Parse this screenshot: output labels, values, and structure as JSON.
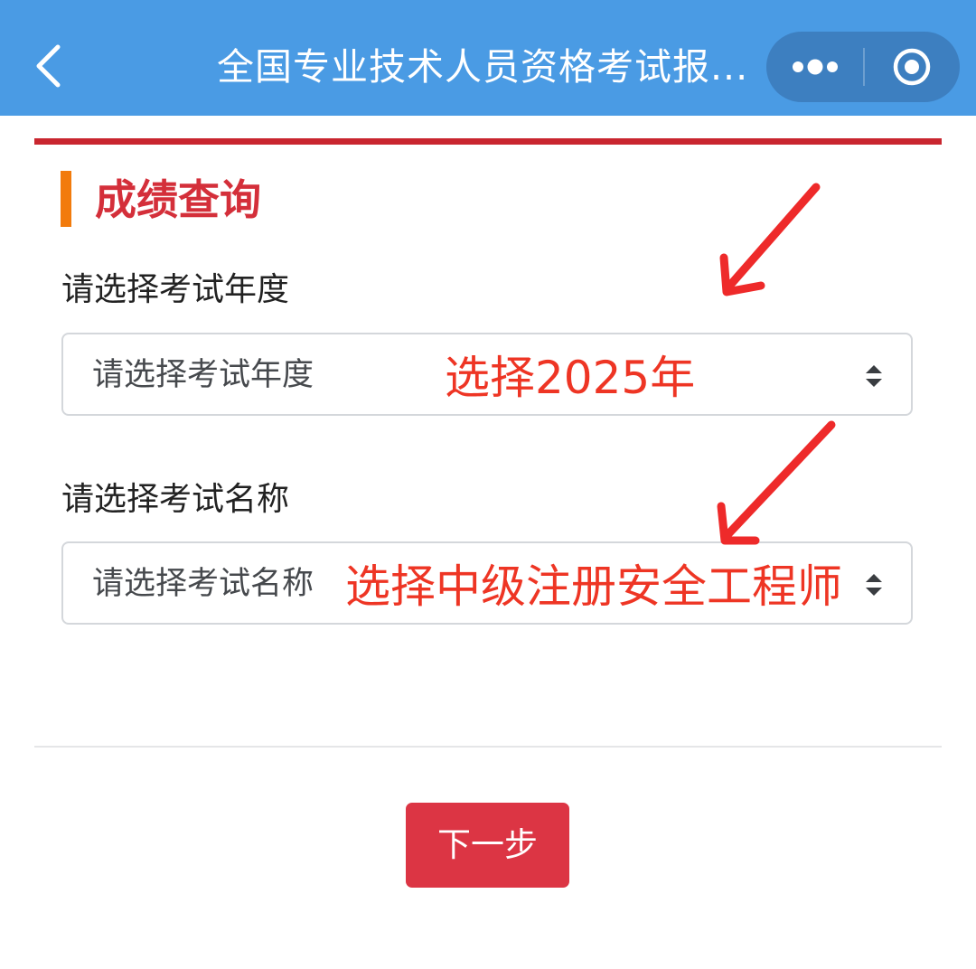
{
  "navbar": {
    "title": "全国专业技术人员资格考试报...",
    "back_icon": "chevron-left-icon",
    "more_icon": "more-dots-icon",
    "close_icon": "target-close-icon",
    "background": "#4a9be4"
  },
  "section": {
    "title": "成绩查询",
    "accent_color": "#f27b0c",
    "title_color": "#d42f3a",
    "rule_color": "#c9262f"
  },
  "form": {
    "year": {
      "label": "请选择考试年度",
      "placeholder": "请选择考试年度"
    },
    "name": {
      "label": "请选择考试名称",
      "placeholder": "请选择考试名称"
    }
  },
  "annotations": {
    "year_note": "选择2025年",
    "name_note": "选择中级注册安全工程师",
    "color": "#ee3524"
  },
  "actions": {
    "next_label": "下一步",
    "next_color": "#dc3544"
  }
}
